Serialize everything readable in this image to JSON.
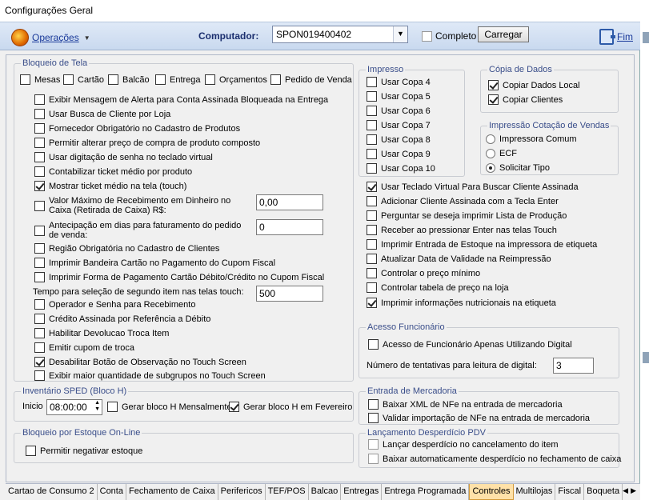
{
  "window": {
    "title": "Configurações Geral"
  },
  "toolbar": {
    "operations_label": "Operações",
    "computer_label": "Computador:",
    "computer_value": "SPON019400402",
    "completo_label": "Completo",
    "completo_checked": false,
    "carregar_label": "Carregar",
    "fim_label": "Fim"
  },
  "bloqueio_tela": {
    "legend": "Bloqueio de Tela",
    "items": [
      "Mesas",
      "Cartão",
      "Balcão",
      "Entrega",
      "Orçamentos",
      "Pedido de Venda"
    ]
  },
  "left_options": [
    {
      "label": "Exibir Mensagem de Alerta para Conta Assinada Bloqueada na Entrega",
      "checked": false
    },
    {
      "label": "Usar Busca de Cliente por Loja",
      "checked": false
    },
    {
      "label": "Fornecedor Obrigatório no Cadastro de Produtos",
      "checked": false
    },
    {
      "label": "Permitir alterar preço de compra de produto composto",
      "checked": false
    },
    {
      "label": "Usar digitação de senha no teclado virtual",
      "checked": false
    },
    {
      "label": "Contabilizar ticket médio por produto",
      "checked": false
    },
    {
      "label": "Mostrar ticket médio na tela (touch)",
      "checked": true
    }
  ],
  "valor_maximo": {
    "label": "Valor Máximo de Recebimento em Dinheiro no Caixa (Retirada de Caixa) R$:",
    "value": "0,00"
  },
  "antecipacao": {
    "label": "Antecipação em dias para faturamento do pedido de venda:",
    "value": "0"
  },
  "left_options_2": [
    {
      "label": "Região Obrigatória no Cadastro de Clientes",
      "checked": false
    },
    {
      "label": "Imprimir Bandeira Cartão no Pagamento do Cupom Fiscal",
      "checked": false
    },
    {
      "label": "Imprimir Forma de Pagamento Cartão Débito/Crédito no Cupom Fiscal",
      "checked": false
    }
  ],
  "tempo_selecao": {
    "label": "Tempo para seleção de segundo item nas telas touch:",
    "value": "500"
  },
  "left_options_3": [
    {
      "label": "Operador e Senha para Recebimento",
      "checked": false
    },
    {
      "label": "Crédito Assinada por Referência a Débito",
      "checked": false
    },
    {
      "label": "Habilitar Devolucao Troca Item",
      "checked": false
    },
    {
      "label": "Emitir cupom de troca",
      "checked": false
    },
    {
      "label": "Desabilitar Botão de Observação no Touch Screen",
      "checked": true
    },
    {
      "label": "Exibir maior quantidade de subgrupos no Touch Screen",
      "checked": false
    }
  ],
  "inventario": {
    "legend": "Inventário SPED (Bloco H)",
    "inicio_label": "Inicio",
    "inicio_value": "08:00:00",
    "mensal_label": "Gerar bloco H Mensalmente",
    "mensal_checked": false,
    "fevereiro_label": "Gerar bloco H em Fevereiro",
    "fevereiro_checked": true
  },
  "bloqueio_estoque": {
    "legend": "Bloqueio por Estoque On-Line",
    "option": "Permitir negativar estoque",
    "checked": false
  },
  "impresso": {
    "legend": "Impresso",
    "items": [
      "Usar Copa 4",
      "Usar Copa 5",
      "Usar Copa 6",
      "Usar Copa 7",
      "Usar Copa 8",
      "Usar Copa 9",
      "Usar Copa 10"
    ]
  },
  "copia_dados": {
    "legend": "Cópia de Dados",
    "items": [
      {
        "label": "Copiar Dados Local",
        "checked": true
      },
      {
        "label": "Copiar Clientes",
        "checked": true
      }
    ]
  },
  "impressao_cotacao": {
    "legend": "Impressão Cotação de Vendas",
    "items": [
      {
        "label": "Impressora Comum",
        "checked": false
      },
      {
        "label": "ECF",
        "checked": false
      },
      {
        "label": "Solicitar Tipo",
        "checked": true
      }
    ]
  },
  "middle_options": [
    {
      "label": "Usar Teclado Virtual Para Buscar Cliente Assinada",
      "checked": true
    },
    {
      "label": "Adicionar Cliente Assinada com a Tecla Enter",
      "checked": false
    },
    {
      "label": "Perguntar se deseja imprimir Lista de Produção",
      "checked": false
    },
    {
      "label": "Receber ao pressionar Enter nas telas Touch",
      "checked": false
    },
    {
      "label": "Imprimir Entrada de Estoque na impressora de etiqueta",
      "checked": false
    },
    {
      "label": "Atualizar Data de Validade na Reimpressão",
      "checked": false
    },
    {
      "label": "Controlar o preço mínimo",
      "checked": false
    },
    {
      "label": "Controlar tabela de preço na loja",
      "checked": false
    },
    {
      "label": "Imprimir informações nutricionais na etiqueta",
      "checked": true
    }
  ],
  "acesso_funcionario": {
    "legend": "Acesso Funcionário",
    "option": "Acesso de Funcionário Apenas Utilizando Digital",
    "checked": false,
    "tentativas_label": "Número de tentativas para leitura de digital:",
    "tentativas_value": "3"
  },
  "entrada_mercadoria": {
    "legend": "Entrada de Mercadoria",
    "items": [
      {
        "label": "Baixar XML de NFe na entrada de mercadoria",
        "checked": false
      },
      {
        "label": "Validar importação de NFe na entrada de mercadoria",
        "checked": false
      }
    ]
  },
  "desperdicio": {
    "legend": "Lançamento Desperdício PDV",
    "items": [
      {
        "label": "Lançar desperdício no cancelamento do item",
        "checked": false
      },
      {
        "label": "Baixar automaticamente desperdício no fechamento de caixa",
        "checked": false
      }
    ]
  },
  "tabs": [
    "Cartao de Consumo 2",
    "Conta",
    "Fechamento de Caixa",
    "Perifericos",
    "TEF/POS",
    "Balcao",
    "Entregas",
    "Entrega Programada",
    "Controles",
    "Multilojas",
    "Fiscal",
    "Boqueta"
  ],
  "active_tab": "Controles"
}
